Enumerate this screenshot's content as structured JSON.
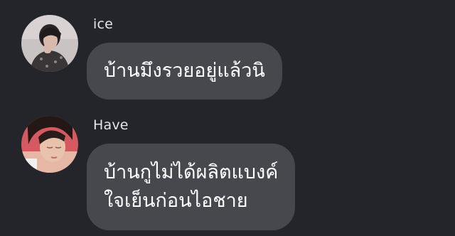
{
  "messages": [
    {
      "sender": "ice",
      "avatar_icon": "user-avatar-ice",
      "lines": [
        "บ้านมึงรวยอยู่แล้วนิ"
      ]
    },
    {
      "sender": "Have",
      "avatar_icon": "user-avatar-have",
      "lines": [
        "บ้านกูไม่ได้ผลิตแบงค์",
        "ใจเย็นก่อนไอชาย"
      ]
    }
  ],
  "colors": {
    "background": "#24252a",
    "bubble": "#47484e",
    "text": "#ffffff",
    "sender_text": "#e6e6e8"
  }
}
